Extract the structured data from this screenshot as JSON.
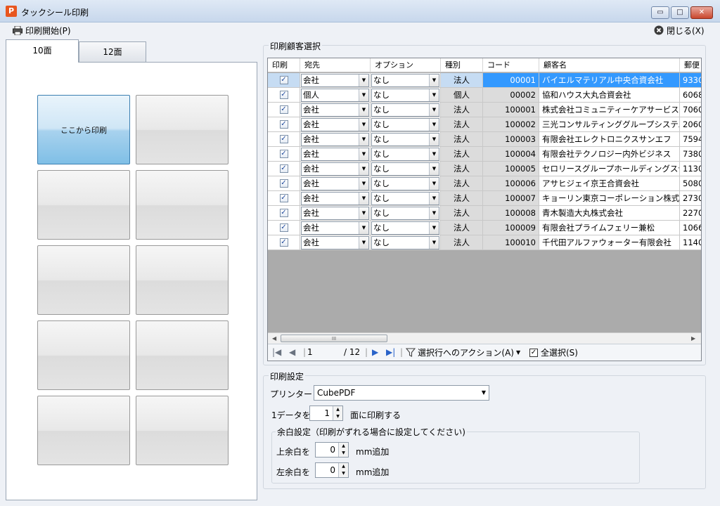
{
  "window": {
    "title": "タックシール印刷",
    "icon_glyph": "P",
    "min_glyph": "▭",
    "max_glyph": "□",
    "close_glyph": "✕"
  },
  "toolbar": {
    "print_label": "印刷開始(P)",
    "close_label": "閉じる(X)"
  },
  "layout_tabs": [
    {
      "label": "10面"
    },
    {
      "label": "12面"
    }
  ],
  "tiles": {
    "first_label": "ここから印刷"
  },
  "customer_select": {
    "group_label": "印刷顧客選択",
    "columns": [
      "印刷",
      "宛先",
      "オプション",
      "種別",
      "コード",
      "顧客名",
      "郵便"
    ],
    "rows": [
      {
        "to": "会社",
        "option": "なし",
        "kind": "法人",
        "code": "00001",
        "name": "バイエルマテリアル中央合資会社",
        "zip": "9330"
      },
      {
        "to": "個人",
        "option": "なし",
        "kind": "個人",
        "code": "00002",
        "name": "協和ハウス大丸合資会社",
        "zip": "6068"
      },
      {
        "to": "会社",
        "option": "なし",
        "kind": "法人",
        "code": "100001",
        "name": "株式会社コミュニティーケアサービスコン...",
        "zip": "7060"
      },
      {
        "to": "会社",
        "option": "なし",
        "kind": "法人",
        "code": "100002",
        "name": "三光コンサルティンググループシステム...",
        "zip": "2060"
      },
      {
        "to": "会社",
        "option": "なし",
        "kind": "法人",
        "code": "100003",
        "name": "有限会社エレクトロニクスサンエフ",
        "zip": "7594"
      },
      {
        "to": "会社",
        "option": "なし",
        "kind": "法人",
        "code": "100004",
        "name": "有限会社テクノロジー内外ビジネス",
        "zip": "7380"
      },
      {
        "to": "会社",
        "option": "なし",
        "kind": "法人",
        "code": "100005",
        "name": "セロリースグループホールディングス合...",
        "zip": "1130"
      },
      {
        "to": "会社",
        "option": "なし",
        "kind": "法人",
        "code": "100006",
        "name": "アサヒジェイ京王合資会社",
        "zip": "5080"
      },
      {
        "to": "会社",
        "option": "なし",
        "kind": "法人",
        "code": "100007",
        "name": "キョーリン東京コーポレーション株式会社",
        "zip": "2730"
      },
      {
        "to": "会社",
        "option": "なし",
        "kind": "法人",
        "code": "100008",
        "name": "青木製造大丸株式会社",
        "zip": "2270"
      },
      {
        "to": "会社",
        "option": "なし",
        "kind": "法人",
        "code": "100009",
        "name": "有限会社プライムフェリー兼松",
        "zip": "1066"
      },
      {
        "to": "会社",
        "option": "なし",
        "kind": "法人",
        "code": "100010",
        "name": "千代田アルファウォーター有限会社",
        "zip": "1140"
      }
    ],
    "checked_glyph": "✓",
    "dropdown_glyph": "▼",
    "nav": {
      "page": "1",
      "total": "/ 12",
      "action_label": "選択行へのアクション(A)",
      "select_all_label": "全選択(S)",
      "first": "|◀",
      "prev": "◀",
      "next": "▶",
      "last": "▶|",
      "scroll_grip": "III"
    }
  },
  "print_settings": {
    "group_label": "印刷設定",
    "printer_label": "プリンター：",
    "printer_value": "CubePDF",
    "data_prefix": "1データを",
    "data_count": "1",
    "data_suffix": "面に印刷する",
    "margin_group_label": "余白設定（印刷がずれる場合に設定してください)",
    "top_margin_label": "上余白を",
    "top_margin_value": "0",
    "top_margin_unit": "mm追加",
    "left_margin_label": "左余白を",
    "left_margin_value": "0",
    "left_margin_unit": "mm追加"
  },
  "colors": {
    "selection": "#3399ff",
    "tile_selected": "#7fbfe6"
  }
}
